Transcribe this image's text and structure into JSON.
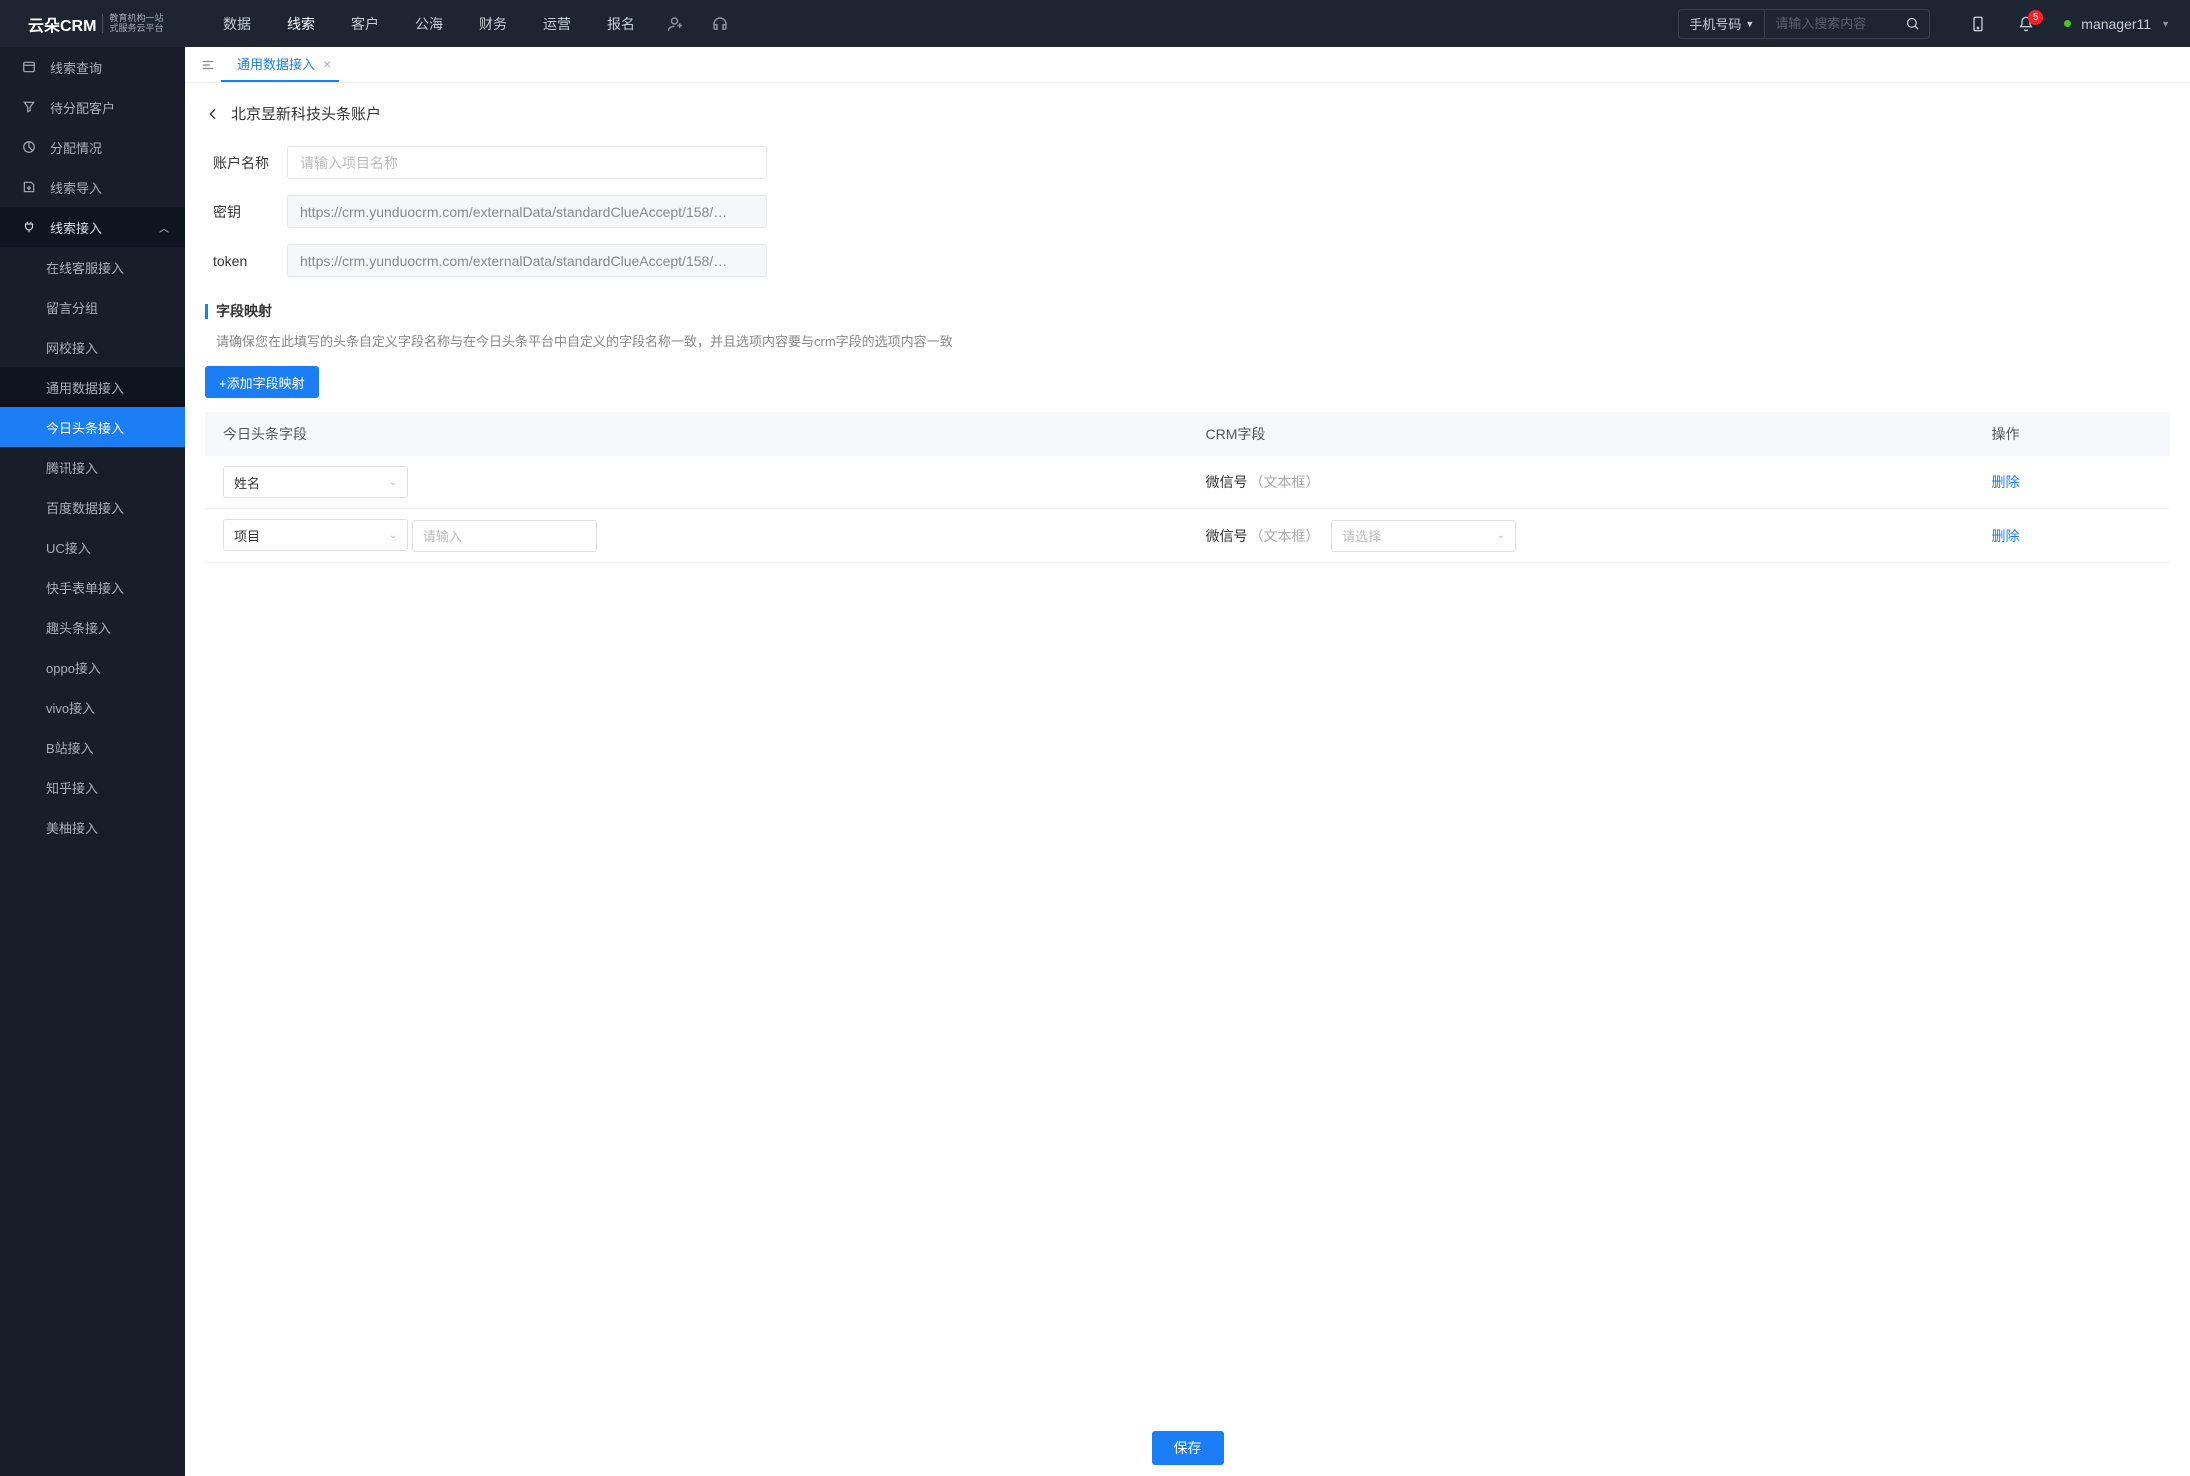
{
  "header": {
    "logo_main": "云朵CRM",
    "logo_sub_l1": "教育机构一站",
    "logo_sub_l2": "式服务云平台",
    "logo_url": "www.yunduocrm.com",
    "nav": [
      "数据",
      "线索",
      "客户",
      "公海",
      "财务",
      "运营",
      "报名"
    ],
    "nav_active_index": 1,
    "search_type": "手机号码",
    "search_placeholder": "请输入搜索内容",
    "badge_count": "5",
    "username": "manager11"
  },
  "sidebar": {
    "top": [
      {
        "icon": "list",
        "label": "线索查询"
      },
      {
        "icon": "funnel",
        "label": "待分配客户"
      },
      {
        "icon": "pie",
        "label": "分配情况"
      },
      {
        "icon": "import",
        "label": "线索导入"
      }
    ],
    "group_label": "线索接入",
    "subs": [
      "在线客服接入",
      "留言分组",
      "网校接入",
      "通用数据接入",
      "今日头条接入",
      "腾讯接入",
      "百度数据接入",
      "UC接入",
      "快手表单接入",
      "趣头条接入",
      "oppo接入",
      "vivo接入",
      "B站接入",
      "知乎接入",
      "美柚接入"
    ],
    "active_sub_index": 4
  },
  "tabs": {
    "current": "通用数据接入"
  },
  "page": {
    "title": "北京昱新科技头条账户",
    "form": {
      "name_label": "账户名称",
      "name_placeholder": "请输入项目名称",
      "secret_label": "密钥",
      "secret_value": "https://crm.yunduocrm.com/externalData/standardClueAccept/158/…",
      "token_label": "token",
      "token_value": "https://crm.yunduocrm.com/externalData/standardClueAccept/158/…"
    },
    "section": {
      "title": "字段映射",
      "hint": "请确保您在此填写的头条自定义字段名称与在今日头条平台中自定义的字段名称一致，并且选项内容要与crm字段的选项内容一致",
      "add_btn": "+添加字段映射"
    },
    "table": {
      "headers": [
        "今日头条字段",
        "CRM字段",
        "操作"
      ],
      "rows": [
        {
          "field": "姓名",
          "crm_label": "微信号",
          "crm_sub": "（文本框）",
          "has_input": false,
          "has_select": false,
          "op": "删除"
        },
        {
          "field": "项目",
          "input_ph": "请输入",
          "crm_label": "微信号",
          "crm_sub": "（文本框）",
          "has_input": true,
          "has_select": true,
          "select_ph": "请选择",
          "op": "删除"
        }
      ]
    },
    "save_btn": "保存"
  }
}
